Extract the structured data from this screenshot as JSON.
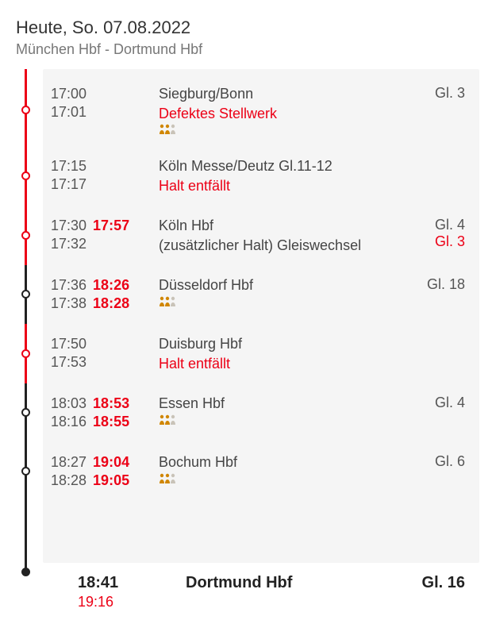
{
  "header": {
    "date": "Heute, So. 07.08.2022",
    "route": "München Hbf - Dortmund Hbf"
  },
  "stops": [
    {
      "arr": "17:00",
      "dep": "17:01",
      "arr_actual": "",
      "dep_actual": "",
      "station": "Siegburg/Bonn",
      "note": "",
      "warning": "Defektes Stellwerk",
      "occupancy": true,
      "platform": "Gl. 3",
      "platform_warn": "",
      "dot": "red"
    },
    {
      "arr": "17:15",
      "dep": "17:17",
      "arr_actual": "",
      "dep_actual": "",
      "station": "Köln Messe/Deutz Gl.11-12",
      "note": "",
      "warning": "Halt entfällt",
      "occupancy": false,
      "platform": "",
      "platform_warn": "",
      "dot": "red"
    },
    {
      "arr": "17:30",
      "dep": "17:32",
      "arr_actual": "",
      "dep_actual": "17:57",
      "station": "Köln Hbf",
      "note": "(zusätzlicher Halt) Gleiswechsel",
      "warning": "",
      "occupancy": false,
      "platform": "Gl. 4",
      "platform_warn": "Gl. 3",
      "dot": "red"
    },
    {
      "arr": "17:36",
      "dep": "17:38",
      "arr_actual": "18:26",
      "dep_actual": "18:28",
      "station": "Düsseldorf Hbf",
      "note": "",
      "warning": "",
      "occupancy": true,
      "platform": "Gl. 18",
      "platform_warn": "",
      "dot": "black"
    },
    {
      "arr": "17:50",
      "dep": "17:53",
      "arr_actual": "",
      "dep_actual": "",
      "station": "Duisburg Hbf",
      "note": "",
      "warning": "Halt entfällt",
      "occupancy": false,
      "platform": "",
      "platform_warn": "",
      "dot": "red"
    },
    {
      "arr": "18:03",
      "dep": "18:16",
      "arr_actual": "18:53",
      "dep_actual": "18:55",
      "station": "Essen Hbf",
      "note": "",
      "warning": "",
      "occupancy": true,
      "platform": "Gl. 4",
      "platform_warn": "",
      "dot": "black"
    },
    {
      "arr": "18:27",
      "dep": "18:28",
      "arr_actual": "19:04",
      "dep_actual": "19:05",
      "station": "Bochum Hbf",
      "note": "",
      "warning": "",
      "occupancy": true,
      "platform": "Gl. 6",
      "platform_warn": "",
      "dot": "black"
    }
  ],
  "final": {
    "sched": "18:41",
    "actual": "19:16",
    "station": "Dortmund Hbf",
    "platform": "Gl. 16"
  },
  "icons": {
    "occupancy": "occupancy-icon"
  }
}
